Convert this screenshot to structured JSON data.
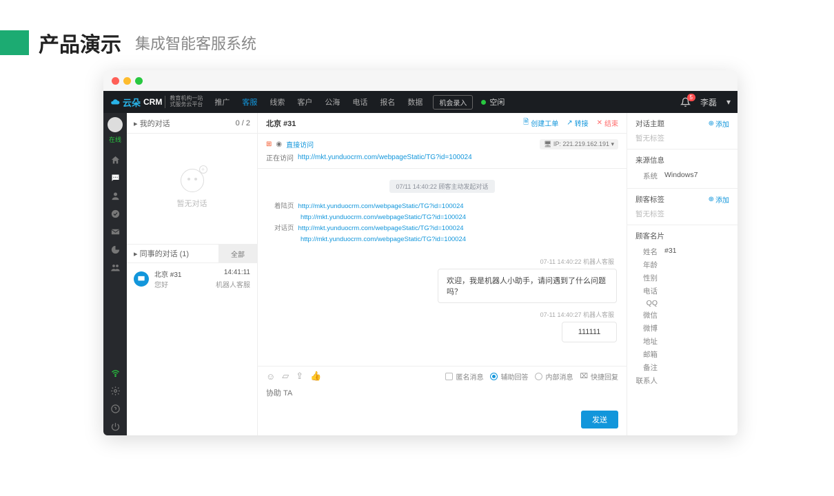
{
  "slide": {
    "title": "产品演示",
    "subtitle": "集成智能客服系统"
  },
  "logo": {
    "brand": "云朵",
    "suffix": "CRM",
    "sub1": "教育机构一站",
    "sub2": "式服务云平台"
  },
  "nav": {
    "items": [
      "推广",
      "客服",
      "线索",
      "客户",
      "公海",
      "电话",
      "报名",
      "数据"
    ],
    "active": "客服",
    "record": "机会录入",
    "status": "空闲",
    "user": "李磊",
    "bell_count": "5"
  },
  "rail": {
    "status": "在线"
  },
  "conv": {
    "mine_title": "我的对话",
    "mine_count": "0 / 2",
    "empty": "暂无对话",
    "colleague_title": "同事的对话  (1)",
    "all": "全部",
    "item": {
      "name": "北京 #31",
      "msg": "您好",
      "time": "14:41:11",
      "src": "机器人客服"
    }
  },
  "chat": {
    "title": "北京 #31",
    "actions": {
      "ticket": "创建工单",
      "transfer": "转接",
      "end": "结束"
    },
    "direct": "直接访问",
    "visiting_label": "正在访问",
    "visiting_url": "http://mkt.yunduocrm.com/webpageStatic/TG?id=100024",
    "ip_label": "IP:",
    "ip": "221.219.162.191",
    "sys_pill": "07/11 14:40:22  顾客主动发起对话",
    "links": {
      "landing_label": "着陆页",
      "landing": [
        "http://mkt.yunduocrm.com/webpageStatic/TG?id=100024",
        "http://mkt.yunduocrm.com/webpageStatic/TG?id=100024"
      ],
      "dialog_label": "对话页",
      "dialog": [
        "http://mkt.yunduocrm.com/webpageStatic/TG?id=100024",
        "http://mkt.yunduocrm.com/webpageStatic/TG?id=100024"
      ]
    },
    "ts1": "07-11 14:40:22  机器人客服",
    "bubble1": "欢迎，我是机器人小助手，请问遇到了什么问题吗？",
    "ts2": "07-11 14:40:27  机器人客服",
    "bubble2": "111111",
    "opts": {
      "anon": "匿名消息",
      "assist": "辅助回答",
      "internal": "内部消息",
      "quick": "快捷回复"
    },
    "placeholder": "协助 TA",
    "send": "发送"
  },
  "info": {
    "topic_title": "对话主题",
    "add": "添加",
    "no_tag": "暂无标签",
    "source_title": "来源信息",
    "system_label": "系统",
    "system": "Windows7",
    "tag_title": "顾客标签",
    "card_title": "顾客名片",
    "card": {
      "name_label": "姓名",
      "name": "#31",
      "age": "年龄",
      "gender": "性别",
      "phone": "电话",
      "qq": "QQ",
      "wechat": "微信",
      "weibo": "微博",
      "addr": "地址",
      "email": "邮箱",
      "remark": "备注",
      "contact": "联系人"
    }
  }
}
